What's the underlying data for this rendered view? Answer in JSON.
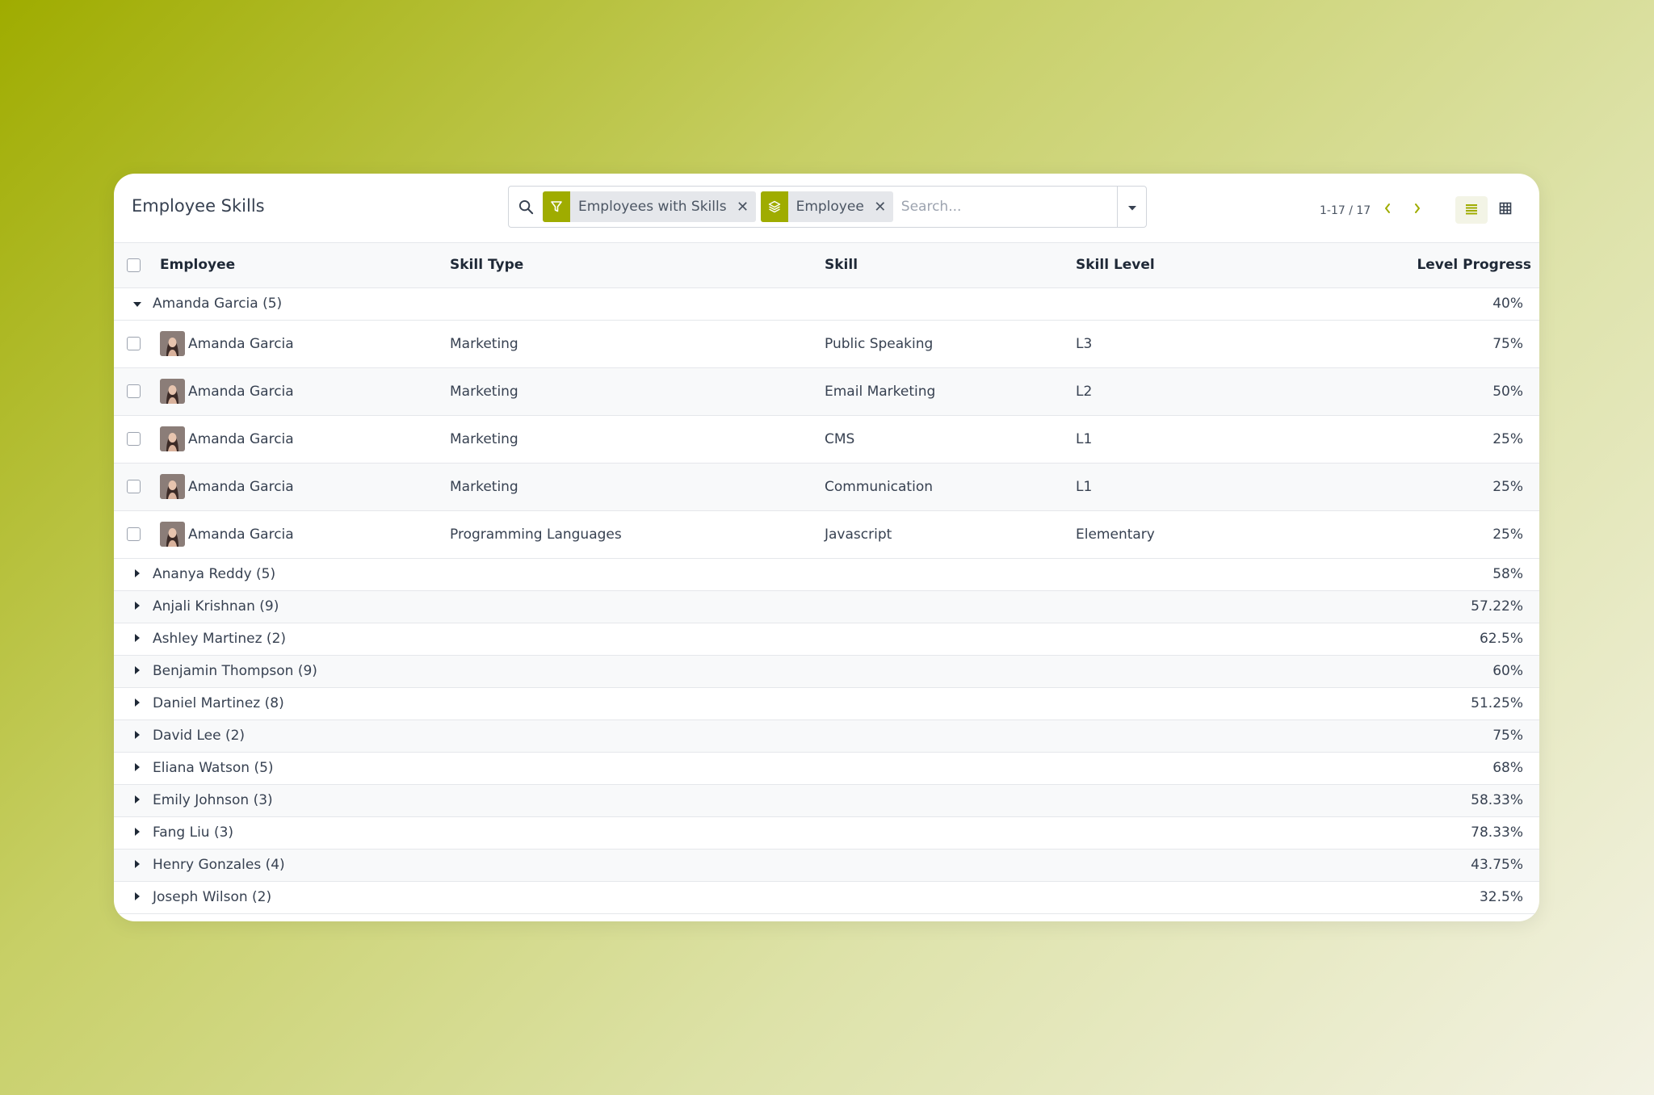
{
  "header": {
    "title": "Employee Skills",
    "search": {
      "facets": [
        {
          "icon": "filter-icon",
          "label": "Employees with Skills"
        },
        {
          "icon": "layers-icon",
          "label": "Employee"
        }
      ],
      "placeholder": "Search..."
    },
    "pager": "1-17 / 17",
    "view_modes": [
      "list-view-icon",
      "pivot-grid-icon"
    ],
    "accent_color": "#9fac00"
  },
  "columns": {
    "employee": "Employee",
    "skill_type": "Skill Type",
    "skill": "Skill",
    "skill_level": "Skill Level",
    "level_progress": "Level Progress"
  },
  "expanded_group": {
    "label": "Amanda Garcia (5)",
    "progress": "40%",
    "records": [
      {
        "employee": "Amanda Garcia",
        "skill_type": "Marketing",
        "skill": "Public Speaking",
        "level": "L3",
        "progress": "75%"
      },
      {
        "employee": "Amanda Garcia",
        "skill_type": "Marketing",
        "skill": "Email Marketing",
        "level": "L2",
        "progress": "50%"
      },
      {
        "employee": "Amanda Garcia",
        "skill_type": "Marketing",
        "skill": "CMS",
        "level": "L1",
        "progress": "25%"
      },
      {
        "employee": "Amanda Garcia",
        "skill_type": "Marketing",
        "skill": "Communication",
        "level": "L1",
        "progress": "25%"
      },
      {
        "employee": "Amanda Garcia",
        "skill_type": "Programming Languages",
        "skill": "Javascript",
        "level": "Elementary",
        "progress": "25%"
      }
    ]
  },
  "groups": [
    {
      "label": "Ananya Reddy (5)",
      "progress": "58%"
    },
    {
      "label": "Anjali Krishnan (9)",
      "progress": "57.22%"
    },
    {
      "label": "Ashley Martinez (2)",
      "progress": "62.5%"
    },
    {
      "label": "Benjamin Thompson (9)",
      "progress": "60%"
    },
    {
      "label": "Daniel Martinez (8)",
      "progress": "51.25%"
    },
    {
      "label": "David Lee (2)",
      "progress": "75%"
    },
    {
      "label": "Eliana Watson (5)",
      "progress": "68%"
    },
    {
      "label": "Emily Johnson (3)",
      "progress": "58.33%"
    },
    {
      "label": "Fang Liu (3)",
      "progress": "78.33%"
    },
    {
      "label": "Henry Gonzales (4)",
      "progress": "43.75%"
    },
    {
      "label": "Joseph Wilson (2)",
      "progress": "32.5%"
    }
  ]
}
